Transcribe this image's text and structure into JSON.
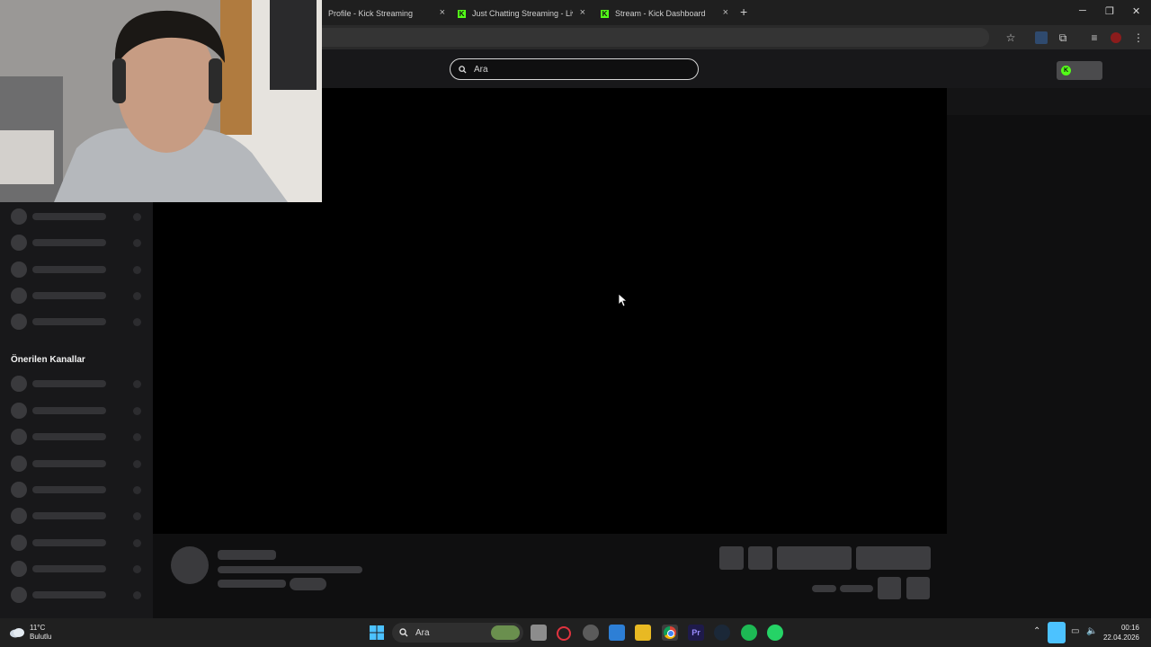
{
  "browser": {
    "tabs": [
      {
        "title": "Profile - Kick Streaming",
        "close": "×"
      },
      {
        "title": "Just Chatting Streaming - Live",
        "close": "×"
      },
      {
        "title": "Stream - Kick Dashboard",
        "close": "×"
      }
    ],
    "new_tab": "+",
    "window_controls": {
      "minimize": "─",
      "restore": "❐",
      "close": "✕"
    }
  },
  "site": {
    "search_placeholder": "Ara"
  },
  "sidebar": {
    "recommended_heading": "Önerilen Kanallar"
  },
  "taskbar": {
    "weather_temp": "11°C",
    "weather_desc": "Bulutlu",
    "search_placeholder": "Ara",
    "time": "00:16",
    "date": "22.04.2026"
  },
  "colors": {
    "brand_green": "#53fc18",
    "player_bg": "#000000",
    "skeleton": "#3a3a3d"
  }
}
